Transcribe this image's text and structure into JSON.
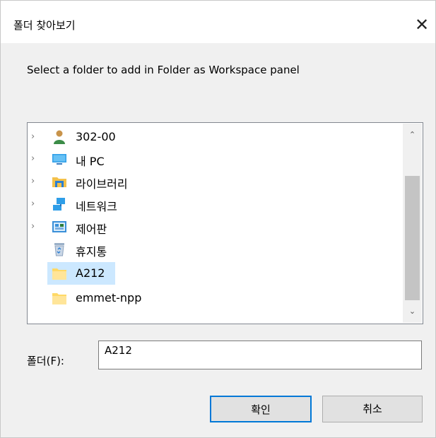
{
  "dialog": {
    "title": "폴더 찾아보기",
    "close_glyph": "✕",
    "instruction": "Select a folder to add in Folder as Workspace panel"
  },
  "tree": {
    "items": [
      {
        "label": "302-00",
        "icon": "user-icon",
        "expandable": true
      },
      {
        "label": "내 PC",
        "icon": "computer-icon",
        "expandable": true
      },
      {
        "label": "라이브러리",
        "icon": "library-icon",
        "expandable": true
      },
      {
        "label": "네트워크",
        "icon": "network-icon",
        "expandable": true
      },
      {
        "label": "제어판",
        "icon": "control-panel-icon",
        "expandable": true
      },
      {
        "label": "휴지통",
        "icon": "recycle-bin-icon",
        "expandable": false
      },
      {
        "label": "A212",
        "icon": "folder-icon",
        "expandable": false,
        "selected": true
      },
      {
        "label": "emmet-npp",
        "icon": "folder-icon",
        "expandable": false
      }
    ],
    "expand_glyph": "›",
    "scroll_up_glyph": "⌃",
    "scroll_down_glyph": "⌄"
  },
  "folder_field": {
    "label": "폴더(F):",
    "value": "A212"
  },
  "buttons": {
    "ok": "확인",
    "cancel": "취소"
  },
  "colors": {
    "selection": "#cce8ff",
    "accent": "#0078d7",
    "folder": "#ffd966"
  }
}
